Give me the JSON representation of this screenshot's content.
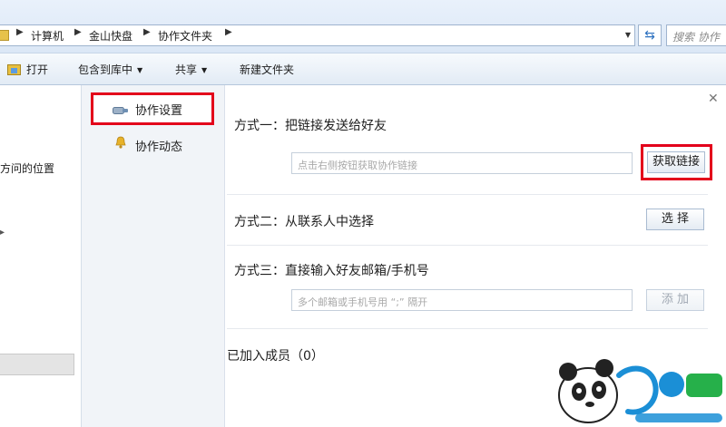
{
  "address_bar": {
    "crumbs": [
      "计算机",
      "金山快盘",
      "协作文件夹"
    ],
    "search_placeholder": "搜索 协作"
  },
  "toolbar": {
    "open_label": "打开",
    "include_library_label": "包含到库中",
    "share_label": "共享",
    "new_folder_label": "新建文件夹"
  },
  "nav_pane": {
    "partial_item": "方问的位置"
  },
  "collab_panel": {
    "menu": [
      {
        "label": "协作设置",
        "icon": "gear-icon",
        "active": true
      },
      {
        "label": "协作动态",
        "icon": "bell-icon",
        "active": false
      }
    ],
    "method1": {
      "title": "方式一：把链接发送给好友",
      "input_placeholder": "点击右侧按钮获取协作链接",
      "button": "获取链接"
    },
    "method2": {
      "title": "方式二：从联系人中选择",
      "button": "选 择"
    },
    "method3": {
      "title": "方式三：直接输入好友邮箱/手机号",
      "input_placeholder": "多个邮箱或手机号用 “;” 隔开",
      "button": "添 加"
    },
    "members_label": "已加入成员（0）"
  },
  "colors": {
    "highlight_red": "#e3001b",
    "panel_side_bg": "#f1f4f8"
  }
}
